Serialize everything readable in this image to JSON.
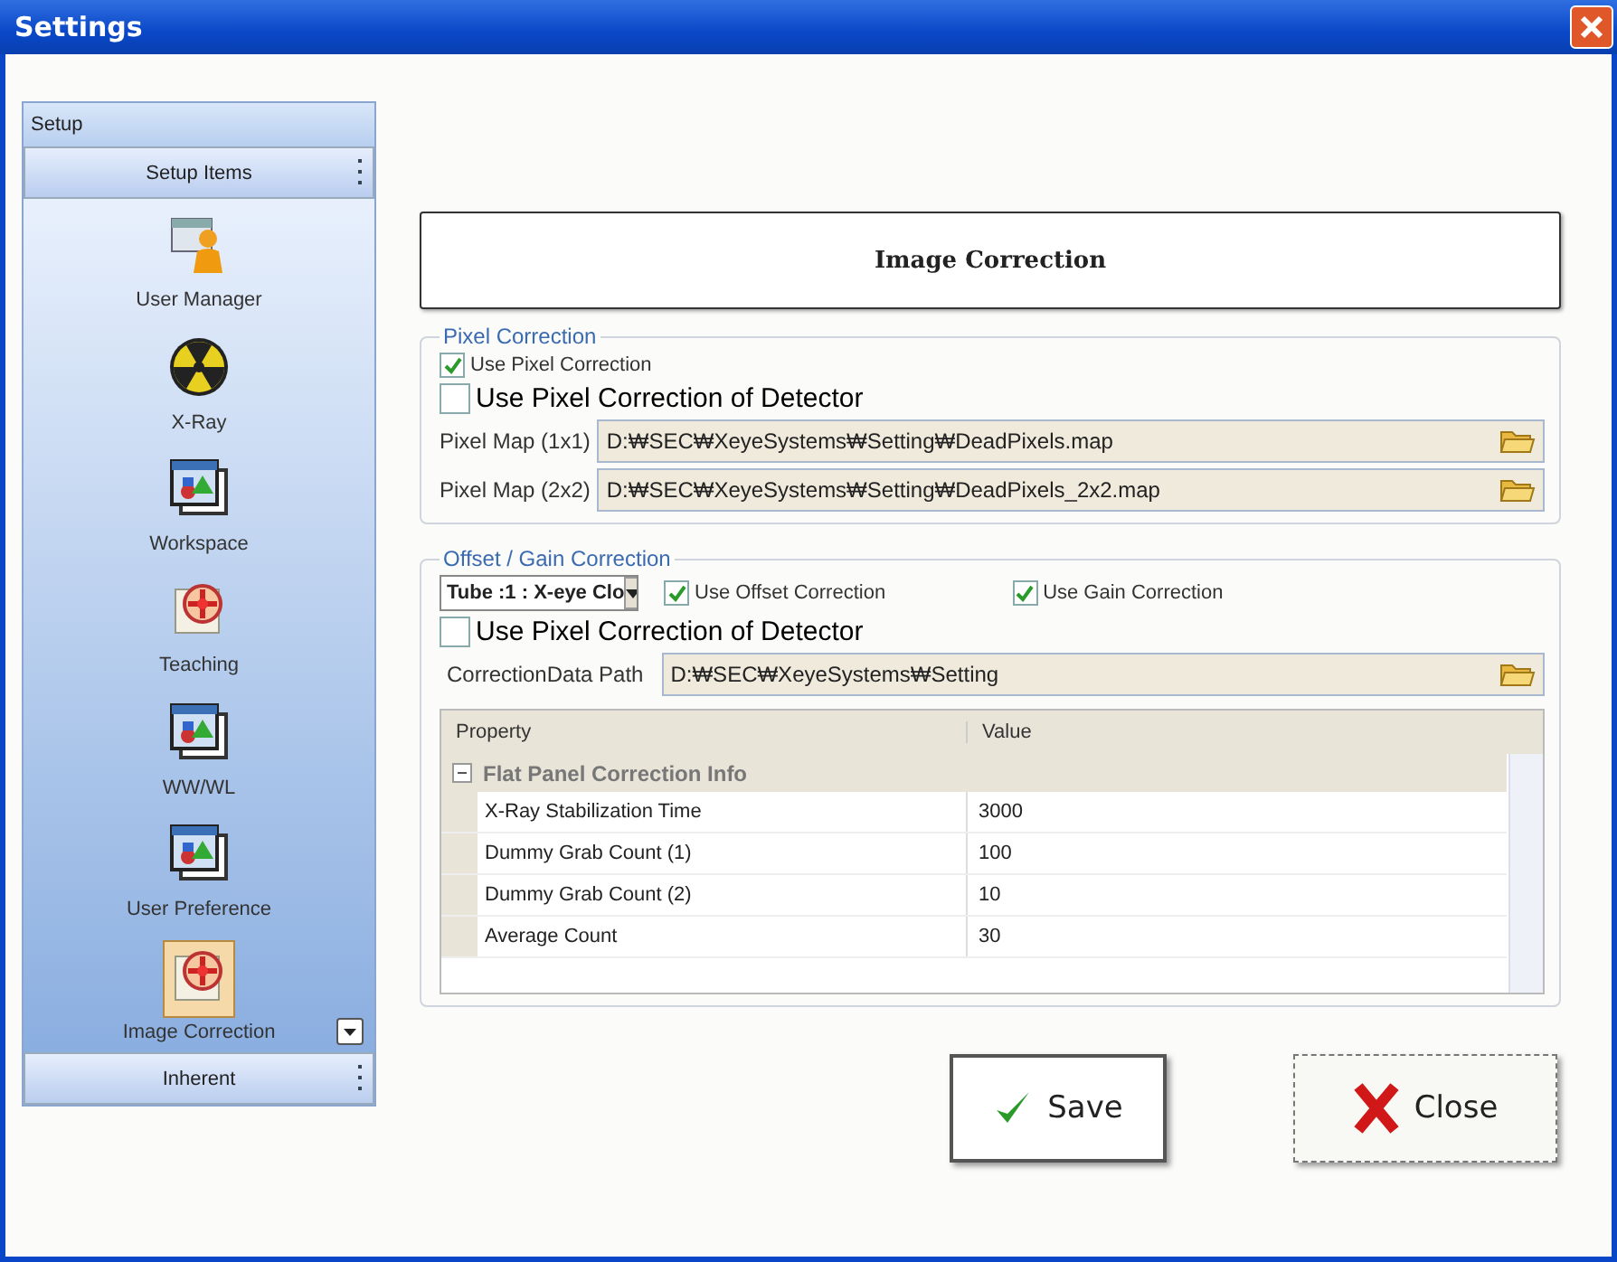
{
  "window": {
    "title": "Settings"
  },
  "sidebar": {
    "header": "Setup",
    "top_group": "Setup Items",
    "bottom_group": "Inherent",
    "items": [
      {
        "label": "User Manager",
        "kind": "user",
        "selected": false
      },
      {
        "label": "X-Ray",
        "kind": "radiation",
        "selected": false
      },
      {
        "label": "Workspace",
        "kind": "window",
        "selected": false
      },
      {
        "label": "Teaching",
        "kind": "target",
        "selected": false
      },
      {
        "label": "WW/WL",
        "kind": "window",
        "selected": false
      },
      {
        "label": "User Preference",
        "kind": "window",
        "selected": false
      },
      {
        "label": "Image Correction",
        "kind": "target",
        "selected": true
      }
    ]
  },
  "heading": "Image Correction",
  "pixel_correction": {
    "title": "Pixel Correction",
    "checkbox": {
      "label": "Use Pixel Correction",
      "checked": true
    },
    "detector_checkbox": {
      "label": "Use Pixel Correction of Detector",
      "checked": false
    },
    "maps": [
      {
        "label": "Pixel Map (1x1)",
        "value": "D:₩SEC₩XeyeSystems₩Setting₩DeadPixels.map"
      },
      {
        "label": "Pixel Map (2x2)",
        "value": "D:₩SEC₩XeyeSystems₩Setting₩DeadPixels_2x2.map"
      }
    ]
  },
  "offset_gain": {
    "title": "Offset / Gain Correction",
    "tube": "Tube :1 : X-eye Clo",
    "checkboxes": [
      {
        "label": "Use Offset Correction",
        "checked": true
      },
      {
        "label": "Use Gain Correction",
        "checked": true
      }
    ],
    "detector_checkbox": {
      "label": "Use Pixel Correction of Detector",
      "checked": false
    },
    "path": {
      "label": "CorrectionData Path",
      "value": "D:₩SEC₩XeyeSystems₩Setting"
    },
    "grid": {
      "columns": [
        "Property",
        "Value"
      ],
      "category": {
        "label": "Flat Panel Correction Info",
        "expanded": true
      },
      "rows": [
        {
          "property": "X-Ray Stabilization Time",
          "value": "3000"
        },
        {
          "property": "Dummy Grab Count (1)",
          "value": "100"
        },
        {
          "property": "Dummy Grab Count (2)",
          "value": "10"
        },
        {
          "property": "Average Count",
          "value": "30"
        }
      ]
    }
  },
  "buttons": [
    {
      "label": "Save",
      "kind": "save"
    },
    {
      "label": "Close",
      "kind": "close"
    }
  ]
}
